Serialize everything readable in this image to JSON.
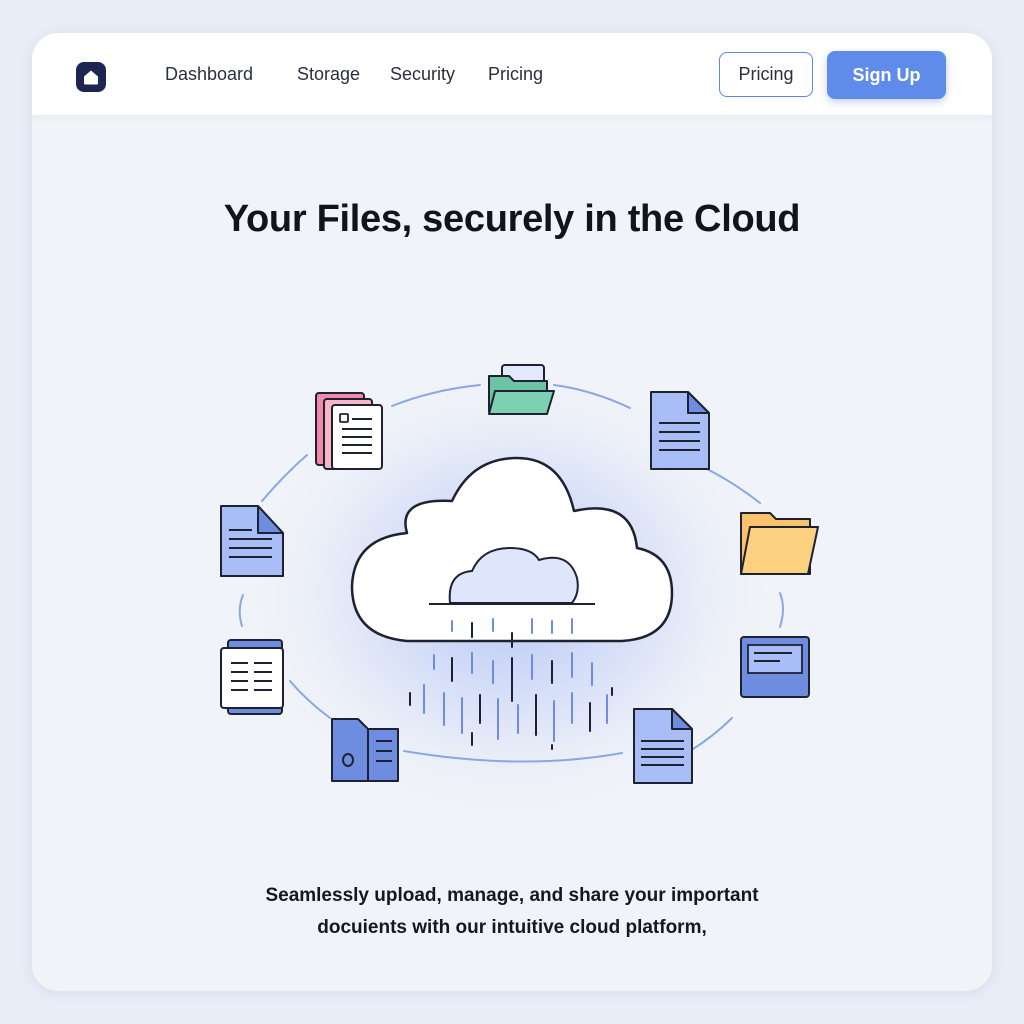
{
  "navbar": {
    "logo_icon": "home-icon",
    "links": [
      "Dashboard",
      "Storage",
      "Security",
      "Pricing"
    ],
    "pricing_button": "Pricing",
    "signup_button": "Sign Up"
  },
  "hero": {
    "title": "Your Files, securely in the Cloud",
    "subtitle_lines": [
      "Seamlessly upload, manage, and share your important",
      "docuients with our intuitive cloud platform,"
    ]
  },
  "illustration": {
    "center_icon": "cloud-icon",
    "orbit_icons": [
      "document-stack-icon",
      "folder-teal-icon",
      "document-icon",
      "folder-yellow-icon",
      "window-icon",
      "document-icon",
      "file-cabinet-icon",
      "document-list-icon",
      "document-icon"
    ]
  },
  "colors": {
    "accent": "#5f8ceb",
    "background": "#e9edf7",
    "panel": "#f0f3f8",
    "logo": "#1d2553",
    "teal": "#6cc4a4",
    "pink": "#f08aa8",
    "yellow": "#f9c26a"
  }
}
